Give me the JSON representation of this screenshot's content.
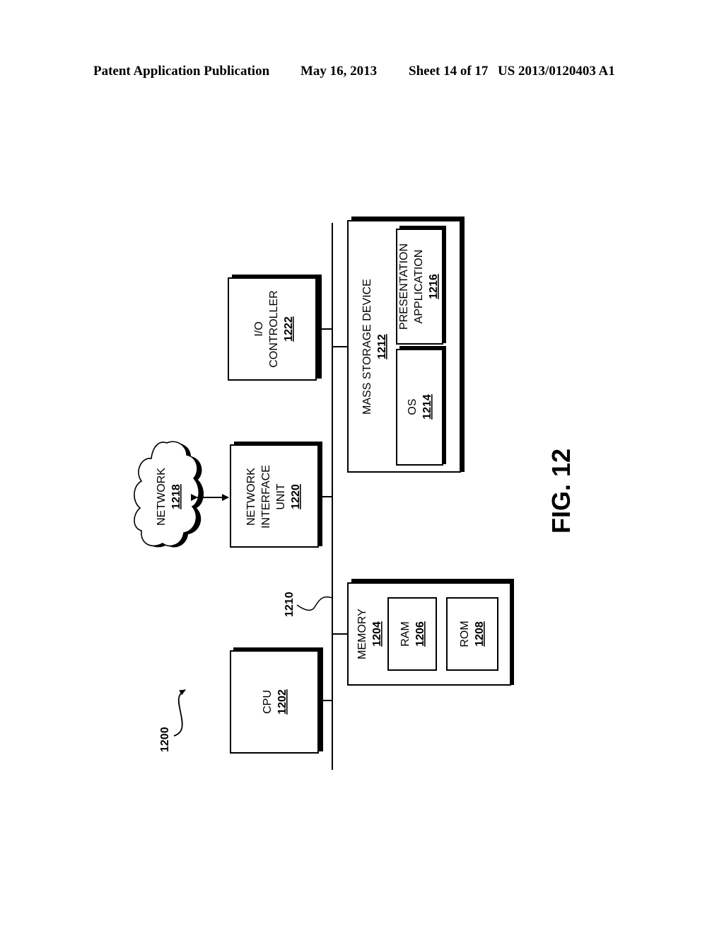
{
  "header": {
    "publication": "Patent Application Publication",
    "date": "May 16, 2013",
    "sheet": "Sheet 14 of 17",
    "number": "US 2013/0120403 A1"
  },
  "figure": {
    "label": "FIG. 12",
    "system_ref": "1200",
    "bus_ref": "1210",
    "components": {
      "cpu": {
        "name": "CPU",
        "ref": "1202"
      },
      "memory": {
        "name": "MEMORY",
        "ref": "1204"
      },
      "ram": {
        "name": "RAM",
        "ref": "1206"
      },
      "rom": {
        "name": "ROM",
        "ref": "1208"
      },
      "network": {
        "name": "NETWORK",
        "ref": "1218"
      },
      "nic": {
        "line1": "NETWORK",
        "line2": "INTERFACE",
        "line3": "UNIT",
        "ref": "1220"
      },
      "io": {
        "line1": "I/O",
        "line2": "CONTROLLER",
        "ref": "1222"
      },
      "mass": {
        "name": "MASS STORAGE DEVICE",
        "ref": "1212"
      },
      "os": {
        "name": "OS",
        "ref": "1214"
      },
      "app": {
        "line1": "PRESENTATION",
        "line2": "APPLICATION",
        "ref": "1216"
      }
    }
  }
}
